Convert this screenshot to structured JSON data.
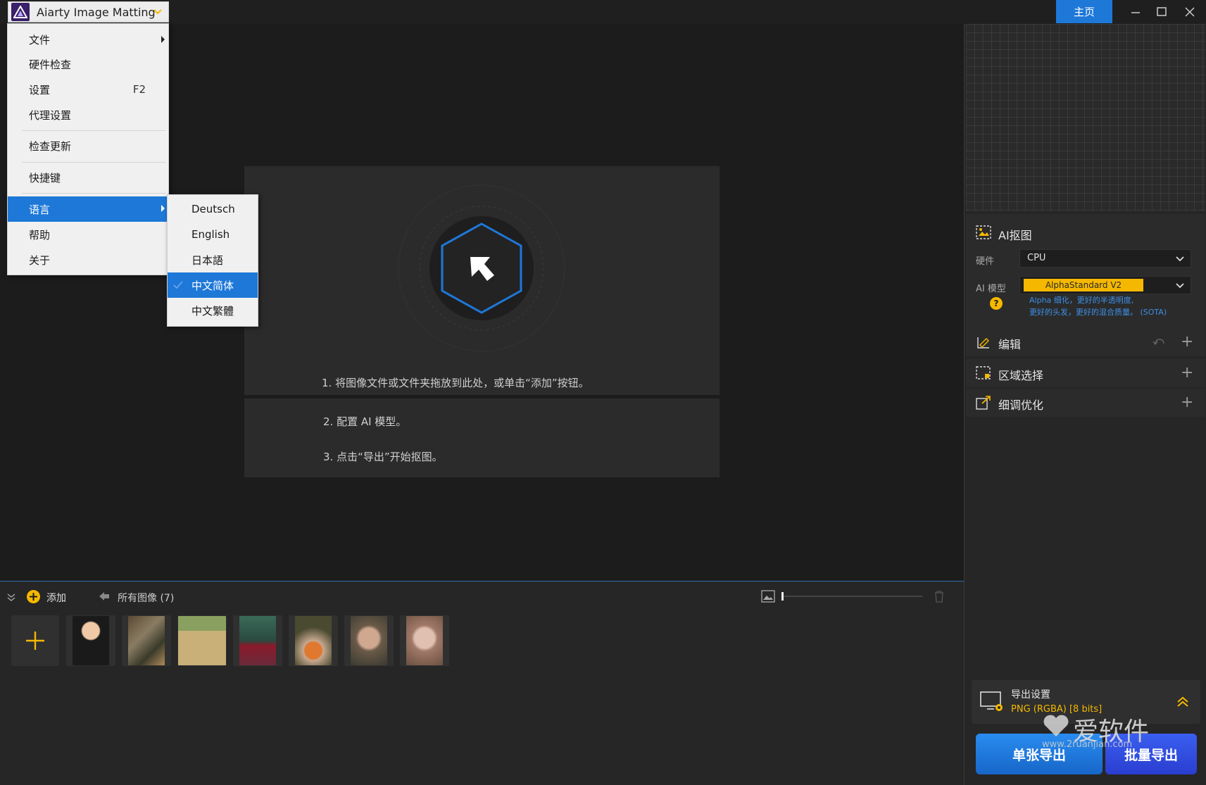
{
  "app": {
    "title": "Aiarty Image Matting",
    "home_label": "主页",
    "accent": "#1e78d8"
  },
  "menu": {
    "items": [
      {
        "label": "文件",
        "shortcut": "",
        "submenu": true
      },
      {
        "label": "硬件检查",
        "shortcut": "",
        "submenu": false
      },
      {
        "label": "设置",
        "shortcut": "F2",
        "submenu": false
      },
      {
        "label": "代理设置",
        "shortcut": "",
        "submenu": false
      },
      {
        "label": "检查更新",
        "shortcut": "",
        "submenu": false
      },
      {
        "label": "快捷键",
        "shortcut": "",
        "submenu": false
      },
      {
        "label": "语言",
        "shortcut": "",
        "submenu": true,
        "active": true
      },
      {
        "label": "帮助",
        "shortcut": "",
        "submenu": false
      },
      {
        "label": "关于",
        "shortcut": "",
        "submenu": false
      }
    ],
    "languages": [
      {
        "label": "Deutsch",
        "selected": false
      },
      {
        "label": "English",
        "selected": false
      },
      {
        "label": "日本語",
        "selected": false
      },
      {
        "label": "中文简体",
        "selected": true
      },
      {
        "label": "中文繁體",
        "selected": false
      }
    ]
  },
  "drop_area": {
    "step1": "1. 将图像文件或文件夹拖放到此处，或单击“添加”按钮。",
    "step2": "2. 配置 AI 模型。",
    "step3": "3. 点击“导出”开始抠图。"
  },
  "right_panel": {
    "ai_section_title": "AI抠图",
    "hardware_label": "硬件",
    "hardware_value": "CPU",
    "model_label": "AI 模型",
    "model_value": "AlphaStandard  V2",
    "model_desc_line1": "Alpha 细化，更好的半透明度,",
    "model_desc_line2": "更好的头发，更好的混合质量。 (SOTA)",
    "edit_title": "编辑",
    "region_title": "区域选择",
    "refine_title": "细调优化",
    "model_color": "#f5b800"
  },
  "bottom": {
    "add_label": "添加",
    "all_images_label": "所有图像 (7)",
    "thumb_count": 7
  },
  "export": {
    "settings_title": "导出设置",
    "settings_value": "PNG (RGBA) [8 bits]",
    "single_label": "单张导出",
    "batch_label": "批量导出"
  },
  "watermark": {
    "text": "爱软件",
    "url": "www.2ruanjian.com"
  }
}
